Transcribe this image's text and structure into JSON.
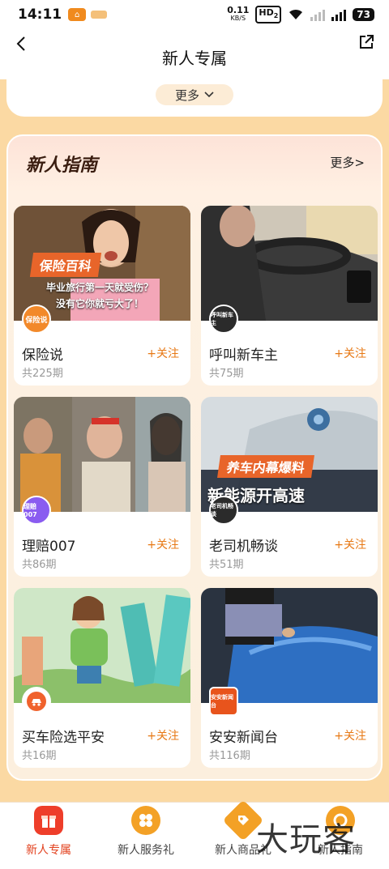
{
  "status_bar": {
    "time": "14:11",
    "speed_value": "0.11",
    "speed_unit": "KB/S",
    "hd_label": "HD",
    "hd_sub": "2",
    "battery": "73"
  },
  "nav": {
    "title": "新人专属"
  },
  "top_section": {
    "more_label": "更多"
  },
  "guide": {
    "title": "新人指南",
    "more_label": "更多>",
    "cards": [
      {
        "name": "保险说",
        "follow": "+关注",
        "count": "共225期",
        "badge": "保险说",
        "badge_color": "#f2892a",
        "overlay_1": "保险百科",
        "overlay_2": "毕业旅行第一天就受伤？",
        "overlay_3": "没有它你就亏大了！"
      },
      {
        "name": "呼叫新车主",
        "follow": "+关注",
        "count": "共75期",
        "badge": "呼叫新车主",
        "badge_color": "#2b2b2b"
      },
      {
        "name": "理赔007",
        "follow": "+关注",
        "count": "共86期",
        "badge": "理赔007",
        "badge_color": "#8a5cf0"
      },
      {
        "name": "老司机畅谈",
        "follow": "+关注",
        "count": "共51期",
        "badge": "老司机畅谈",
        "badge_color": "#2b2b2b",
        "overlay_1": "养车内幕爆料",
        "overlay_2": "新能源开高速"
      },
      {
        "name": "买车险选平安",
        "follow": "+关注",
        "count": "共16期",
        "badge": "",
        "badge_color": "#f0622d"
      },
      {
        "name": "安安新闻台",
        "follow": "+关注",
        "count": "共116期",
        "badge": "安安新闻台",
        "badge_color": "#e8541c"
      }
    ]
  },
  "tabs": [
    {
      "label": "新人专属",
      "active": true,
      "color": "#ee3e2a"
    },
    {
      "label": "新人服务礼",
      "active": false,
      "color": "#f3a126"
    },
    {
      "label": "新人商品礼",
      "active": false,
      "color": "#f3a126"
    },
    {
      "label": "新人指南",
      "active": false,
      "color": "#f3a126"
    }
  ],
  "watermark": "大玩客",
  "colors": {
    "accent": "#e77814",
    "background": "#fbd9a3",
    "active_tab": "#e2401d"
  }
}
